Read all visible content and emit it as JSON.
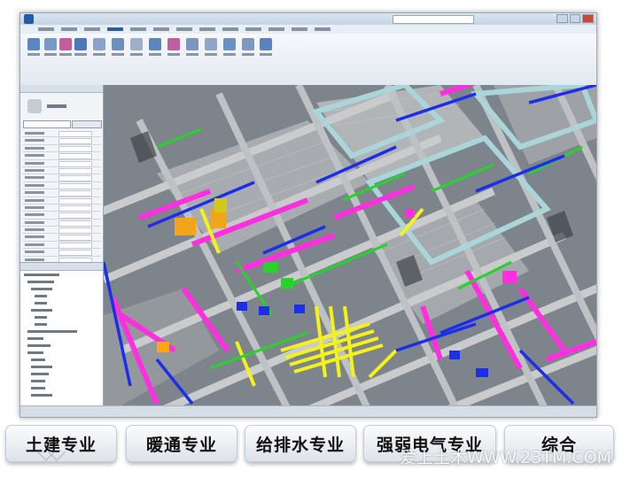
{
  "buttons": [
    {
      "label": "土建专业"
    },
    {
      "label": "暖通专业"
    },
    {
      "label": "给排水专业"
    },
    {
      "label": "强弱电气专业"
    },
    {
      "label": "综合"
    }
  ],
  "watermark": "爱上土木WWW.23TM.COM",
  "colors": {
    "magenta": "#ff2fe0",
    "yellow": "#f3f21a",
    "green": "#27d32b",
    "blue": "#1d2fe6",
    "orange": "#ffa51a",
    "structure": "#c9cbcd",
    "frame": "#a9d6da"
  },
  "icons": [
    "app-logo-icon",
    "properties-icon"
  ]
}
